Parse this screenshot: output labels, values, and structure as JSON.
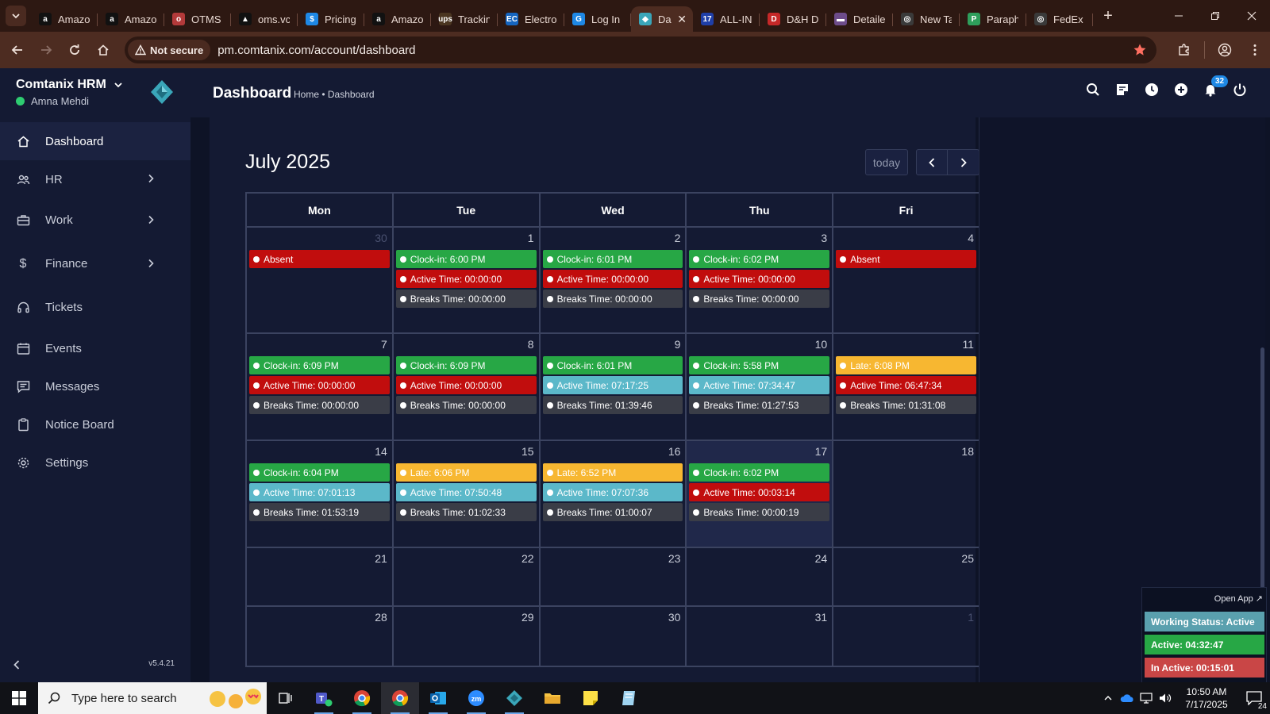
{
  "browser": {
    "tabs": [
      {
        "label": "Amazo",
        "fav": "a",
        "favColor": "#111111"
      },
      {
        "label": "Amazo",
        "fav": "a",
        "favColor": "#111111"
      },
      {
        "label": "OTMS",
        "fav": "o",
        "favColor": "#b33a3a"
      },
      {
        "label": "oms.vc",
        "fav": "▲",
        "favColor": "#111111"
      },
      {
        "label": "Pricing",
        "fav": "$",
        "favColor": "#1e88e5"
      },
      {
        "label": "Amazo",
        "fav": "a",
        "favColor": "#111111"
      },
      {
        "label": "Trackin",
        "fav": "ups",
        "favColor": "#4a3520"
      },
      {
        "label": "Electro",
        "fav": "EC",
        "favColor": "#1565c0"
      },
      {
        "label": "Log In",
        "fav": "G",
        "favColor": "#1e88e5"
      },
      {
        "label": "Da",
        "fav": "◆",
        "favColor": "#3aa6b9",
        "active": true
      },
      {
        "label": "ALL-IN",
        "fav": "17",
        "favColor": "#1f3fa8"
      },
      {
        "label": "D&H D",
        "fav": "D",
        "favColor": "#c62828"
      },
      {
        "label": "Detaile",
        "fav": "▬",
        "favColor": "#6d4c8a"
      },
      {
        "label": "New Ta",
        "fav": "◎",
        "favColor": "#3a3a3a"
      },
      {
        "label": "Paraph",
        "fav": "P",
        "favColor": "#2e9e5b"
      },
      {
        "label": "FedEx",
        "fav": "◎",
        "favColor": "#3a3a3a"
      }
    ],
    "security_label": "Not secure",
    "url": "pm.comtanix.com/account/dashboard"
  },
  "sidebar": {
    "brand": "Comtanix HRM",
    "user": "Amna Mehdi",
    "items": [
      {
        "label": "Dashboard"
      },
      {
        "label": "HR"
      },
      {
        "label": "Work"
      },
      {
        "label": "Finance"
      },
      {
        "label": "Tickets"
      },
      {
        "label": "Events"
      },
      {
        "label": "Messages"
      },
      {
        "label": "Notice Board"
      },
      {
        "label": "Settings"
      }
    ],
    "version": "v5.4.21"
  },
  "header": {
    "title": "Dashboard",
    "breadcrumb": "Home • Dashboard",
    "notification_count": "32"
  },
  "calendar": {
    "title": "July 2025",
    "today_label": "today",
    "days": [
      "Mon",
      "Tue",
      "Wed",
      "Thu",
      "Fri"
    ],
    "weeks": [
      {
        "height": 134,
        "cells": [
          {
            "day": "30",
            "muted": true,
            "events": [
              {
                "color": "red",
                "text": "Absent"
              }
            ]
          },
          {
            "day": "1",
            "events": [
              {
                "color": "green",
                "text": "Clock-in: 6:00 PM"
              },
              {
                "color": "red",
                "text": "Active Time: 00:00:00"
              },
              {
                "color": "gray",
                "text": "Breaks Time: 00:00:00"
              }
            ]
          },
          {
            "day": "2",
            "events": [
              {
                "color": "green",
                "text": "Clock-in: 6:01 PM"
              },
              {
                "color": "red",
                "text": "Active Time: 00:00:00"
              },
              {
                "color": "gray",
                "text": "Breaks Time: 00:00:00"
              }
            ]
          },
          {
            "day": "3",
            "events": [
              {
                "color": "green",
                "text": "Clock-in: 6:02 PM"
              },
              {
                "color": "red",
                "text": "Active Time: 00:00:00"
              },
              {
                "color": "gray",
                "text": "Breaks Time: 00:00:00"
              }
            ]
          },
          {
            "day": "4",
            "events": [
              {
                "color": "red",
                "text": "Absent"
              }
            ]
          }
        ]
      },
      {
        "height": 135,
        "cells": [
          {
            "day": "7",
            "events": [
              {
                "color": "green",
                "text": "Clock-in: 6:09 PM"
              },
              {
                "color": "red",
                "text": "Active Time: 00:00:00"
              },
              {
                "color": "gray",
                "text": "Breaks Time: 00:00:00"
              }
            ]
          },
          {
            "day": "8",
            "events": [
              {
                "color": "green",
                "text": "Clock-in: 6:09 PM"
              },
              {
                "color": "red",
                "text": "Active Time: 00:00:00"
              },
              {
                "color": "gray",
                "text": "Breaks Time: 00:00:00"
              }
            ]
          },
          {
            "day": "9",
            "events": [
              {
                "color": "green",
                "text": "Clock-in: 6:01 PM"
              },
              {
                "color": "teal",
                "text": "Active Time: 07:17:25"
              },
              {
                "color": "gray",
                "text": "Breaks Time: 01:39:46"
              }
            ]
          },
          {
            "day": "10",
            "events": [
              {
                "color": "green",
                "text": "Clock-in: 5:58 PM"
              },
              {
                "color": "teal",
                "text": "Active Time: 07:34:47"
              },
              {
                "color": "gray",
                "text": "Breaks Time: 01:27:53"
              }
            ]
          },
          {
            "day": "11",
            "events": [
              {
                "color": "yellow",
                "text": "Late: 6:08 PM"
              },
              {
                "color": "red",
                "text": "Active Time: 06:47:34"
              },
              {
                "color": "gray",
                "text": "Breaks Time: 01:31:08"
              }
            ]
          }
        ]
      },
      {
        "height": 135,
        "cells": [
          {
            "day": "14",
            "events": [
              {
                "color": "green",
                "text": "Clock-in: 6:04 PM"
              },
              {
                "color": "teal",
                "text": "Active Time: 07:01:13"
              },
              {
                "color": "gray",
                "text": "Breaks Time: 01:53:19"
              }
            ]
          },
          {
            "day": "15",
            "events": [
              {
                "color": "yellow",
                "text": "Late: 6:06 PM"
              },
              {
                "color": "teal",
                "text": "Active Time: 07:50:48"
              },
              {
                "color": "gray",
                "text": "Breaks Time: 01:02:33"
              }
            ]
          },
          {
            "day": "16",
            "events": [
              {
                "color": "yellow",
                "text": "Late: 6:52 PM"
              },
              {
                "color": "teal",
                "text": "Active Time: 07:07:36"
              },
              {
                "color": "gray",
                "text": "Breaks Time: 01:00:07"
              }
            ]
          },
          {
            "day": "17",
            "today": true,
            "events": [
              {
                "color": "green",
                "text": "Clock-in: 6:02 PM"
              },
              {
                "color": "red",
                "text": "Active Time: 00:03:14"
              },
              {
                "color": "gray",
                "text": "Breaks Time: 00:00:19"
              }
            ]
          },
          {
            "day": "18",
            "events": []
          }
        ]
      },
      {
        "height": 74,
        "cells": [
          {
            "day": "21",
            "events": []
          },
          {
            "day": "22",
            "events": []
          },
          {
            "day": "23",
            "events": []
          },
          {
            "day": "24",
            "events": []
          },
          {
            "day": "25",
            "events": []
          }
        ]
      },
      {
        "height": 76,
        "cells": [
          {
            "day": "28",
            "events": []
          },
          {
            "day": "29",
            "events": []
          },
          {
            "day": "30",
            "events": []
          },
          {
            "day": "31",
            "events": []
          },
          {
            "day": "1",
            "muted": true,
            "events": []
          }
        ]
      }
    ]
  },
  "widget": {
    "open_app": "Open App ↗",
    "status": "Working Status: Active",
    "active": "Active: 04:32:47",
    "inactive": "In Active: 00:15:01"
  },
  "taskbar": {
    "search_placeholder": "Type here to search",
    "time": "10:50 AM",
    "date": "7/17/2025",
    "notification_count": "24"
  }
}
